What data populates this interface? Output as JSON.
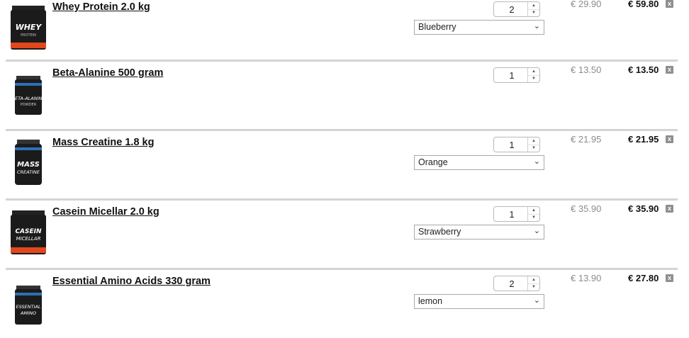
{
  "cart": {
    "remove_icon_text": "x",
    "items": [
      {
        "name": "Whey Protein 2.0 kg",
        "quantity": "2",
        "flavor": "Blueberry",
        "unit_price": "€ 29.90",
        "total": "€ 59.80",
        "image": "whey-protein-tub-icon",
        "accent": "#e3471d"
      },
      {
        "name": "Beta-Alanine 500 gram",
        "quantity": "1",
        "unit_price": "€ 13.50",
        "total": "€ 13.50",
        "image": "beta-alanine-tub-icon",
        "accent": "#2f6fb5"
      },
      {
        "name": "Mass Creatine 1.8 kg",
        "quantity": "1",
        "flavor": "Orange",
        "unit_price": "€ 21.95",
        "total": "€ 21.95",
        "image": "mass-creatine-tub-icon",
        "accent": "#2f6fb5"
      },
      {
        "name": "Casein Micellar 2.0 kg",
        "quantity": "1",
        "flavor": "Strawberry",
        "unit_price": "€ 35.90",
        "total": "€ 35.90",
        "image": "casein-micellar-tub-icon",
        "accent": "#e3471d"
      },
      {
        "name": "Essential Amino Acids 330 gram",
        "quantity": "2",
        "flavor": "lemon",
        "unit_price": "€ 13.90",
        "total": "€ 27.80",
        "image": "amino-acids-tub-icon",
        "accent": "#2f6fb5"
      }
    ]
  }
}
